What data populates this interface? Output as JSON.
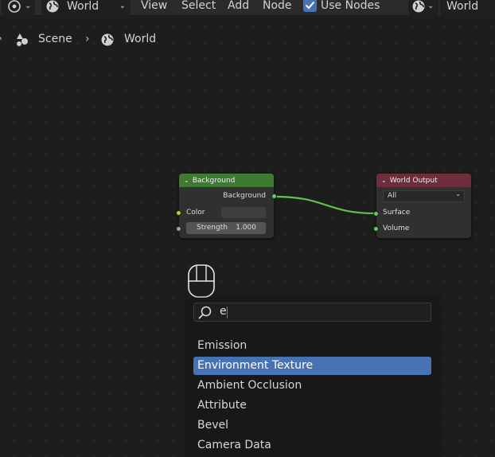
{
  "header": {
    "world_dropdown_label": "World",
    "menu": [
      "View",
      "Select",
      "Add",
      "Node"
    ],
    "use_nodes_label": "Use Nodes",
    "use_nodes_checked": true,
    "right_dropdown_label": "World"
  },
  "breadcrumb": {
    "scene": "Scene",
    "world": "World"
  },
  "nodes": {
    "background": {
      "title": "Background",
      "output": "Background",
      "inputs": {
        "color_label": "Color",
        "strength_label": "Strength",
        "strength_value": "1.000"
      },
      "header_color": "#3f7a33"
    },
    "world_output": {
      "title": "World Output",
      "target": "All",
      "inputs": [
        "Surface",
        "Volume"
      ],
      "header_color": "#6d2d3a"
    }
  },
  "search": {
    "query": "e",
    "results": [
      "Emission",
      "Environment Texture",
      "Ambient Occlusion",
      "Attribute",
      "Bevel",
      "Camera Data"
    ],
    "selected_index": 1
  },
  "colors": {
    "accent": "#4772b3",
    "link": "#5fc04a",
    "socket_shader": "#63c763",
    "socket_color": "#c7c729",
    "socket_float": "#a1a1a1"
  }
}
